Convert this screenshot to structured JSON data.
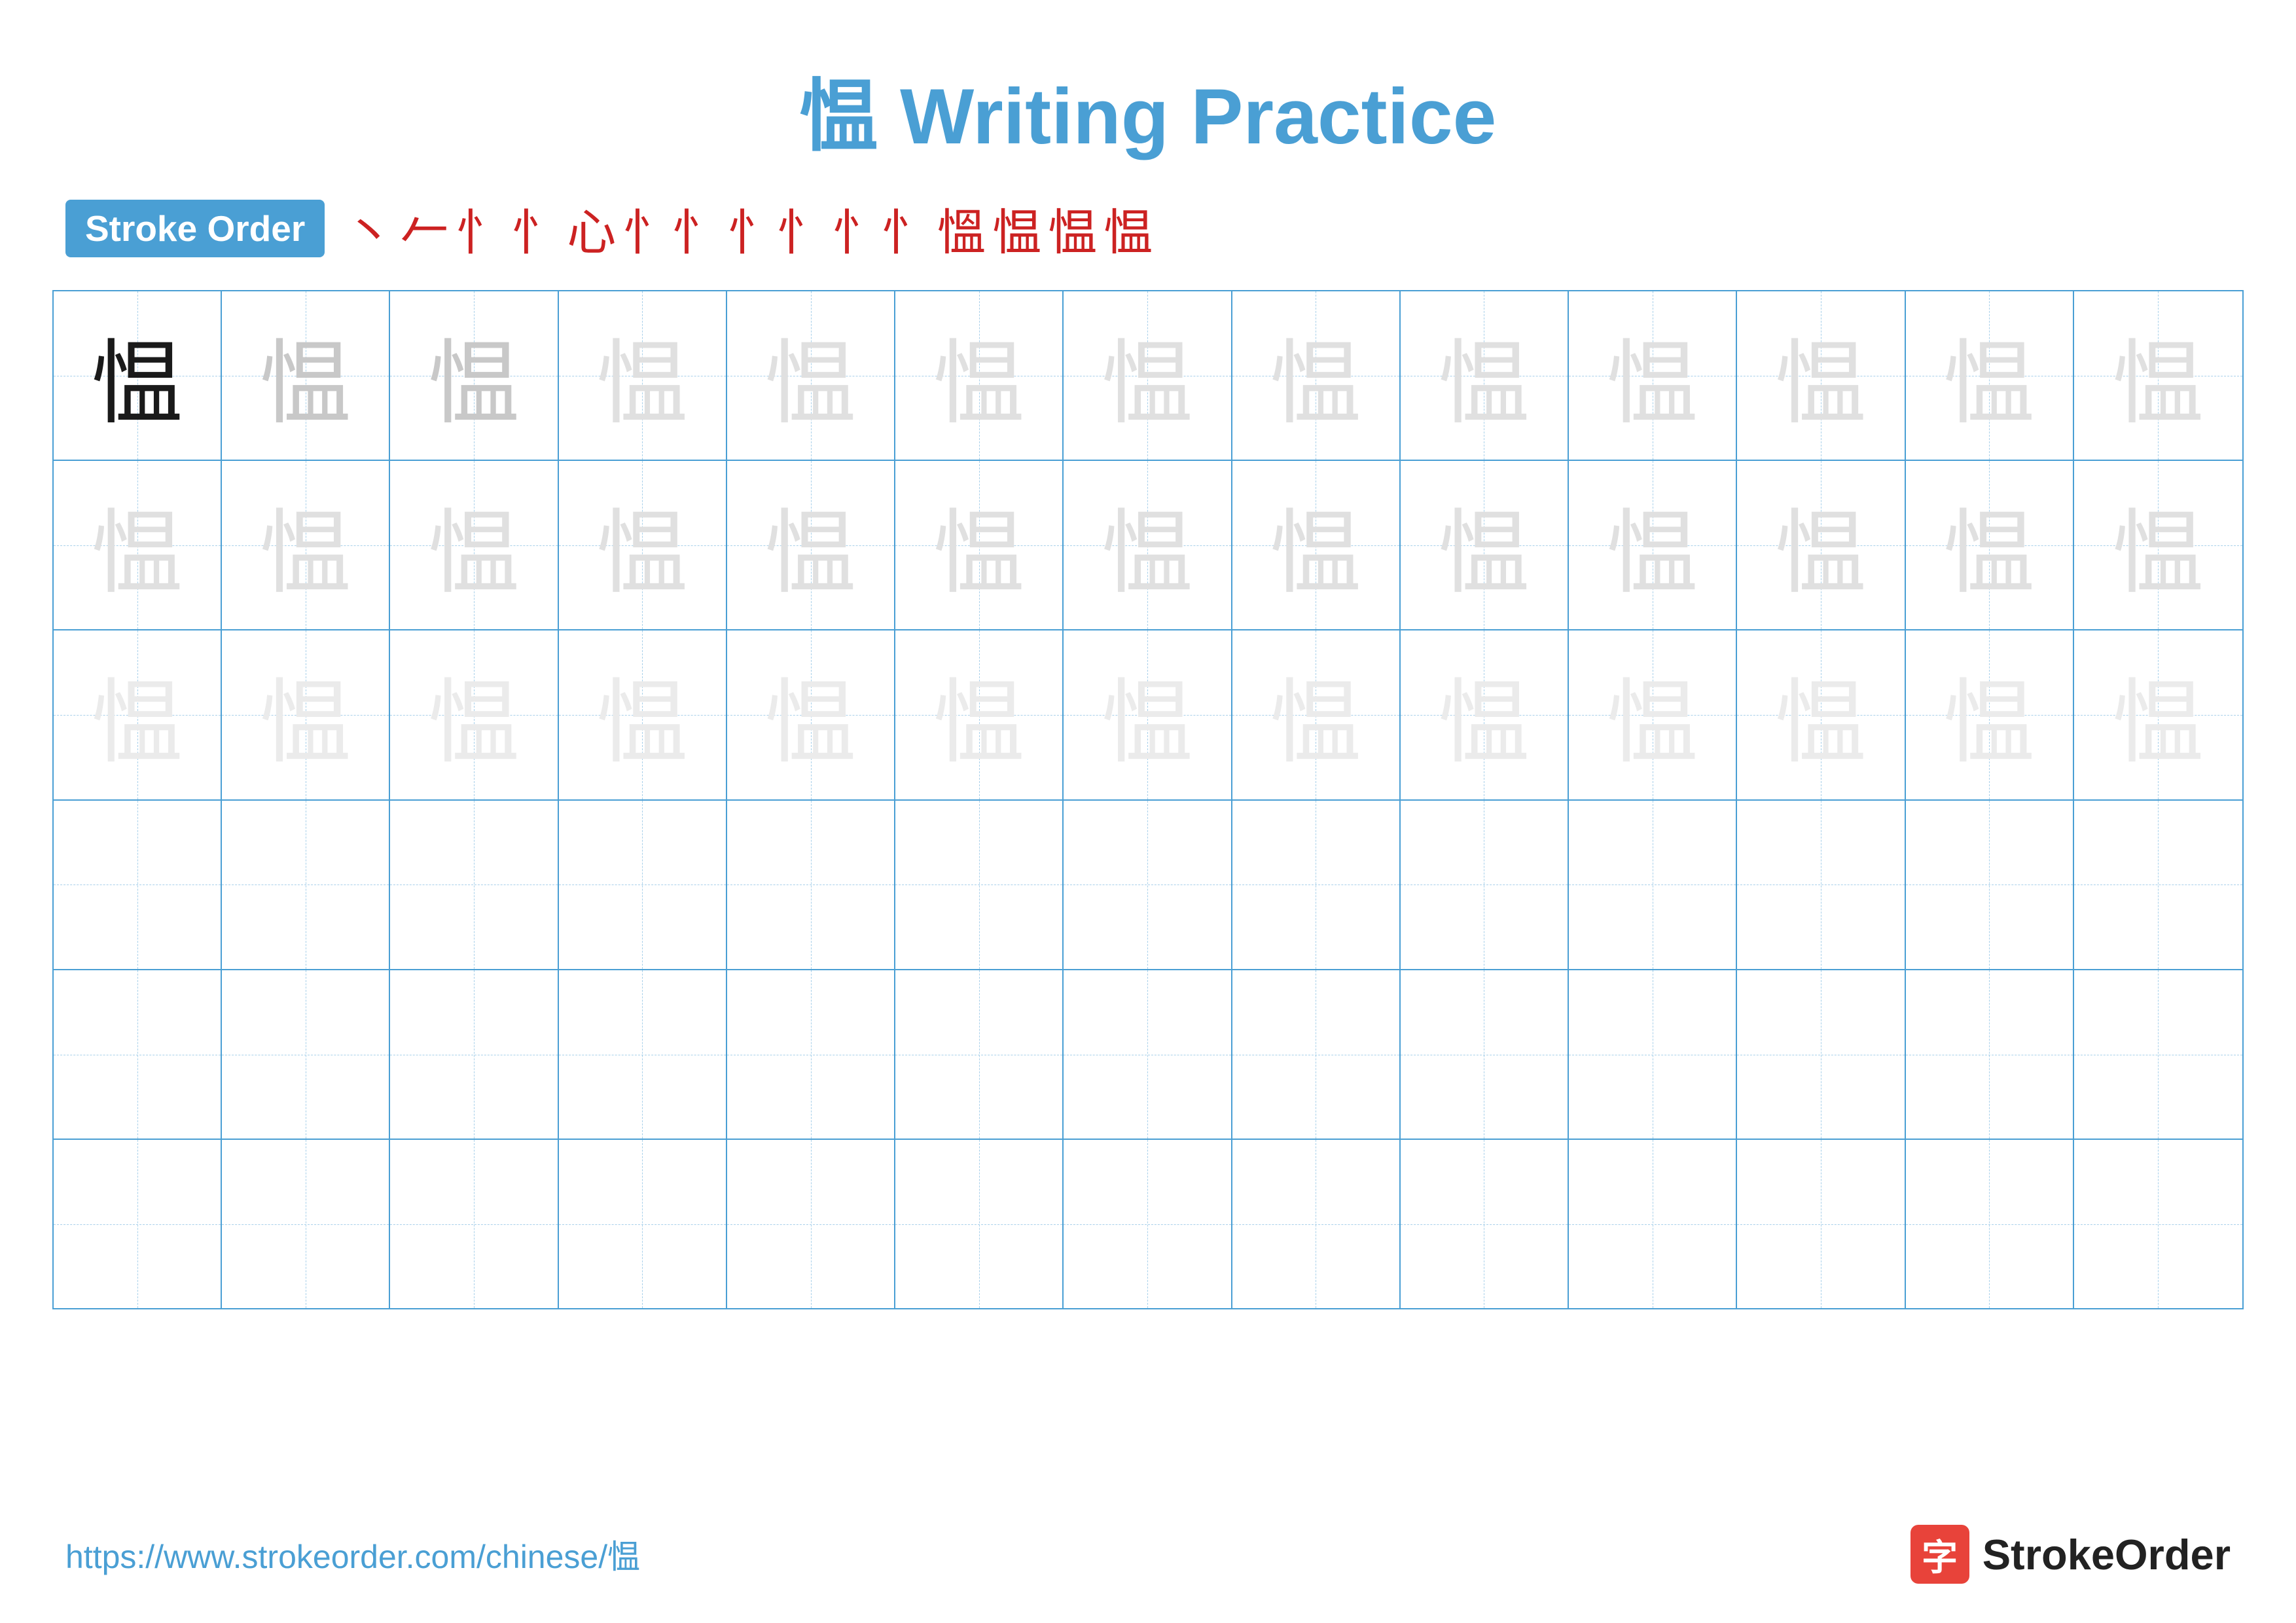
{
  "title": {
    "char": "愠",
    "label": "Writing Practice"
  },
  "stroke_order": {
    "badge": "Stroke Order",
    "strokes": [
      "丶",
      "𠃌",
      "忄",
      "忄",
      "忄忄",
      "忄忄",
      "忄忄",
      "忄忄",
      "愠",
      "愠",
      "愠",
      "愠"
    ]
  },
  "grid": {
    "char": "愠",
    "rows": 6,
    "cols": 13
  },
  "footer": {
    "url": "https://www.strokeorder.com/chinese/愠",
    "logo_text": "StrokeOrder",
    "logo_char": "字"
  }
}
